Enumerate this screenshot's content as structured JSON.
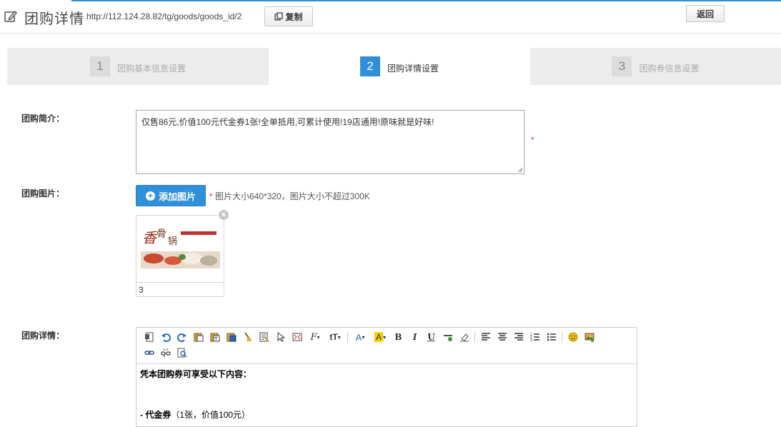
{
  "header": {
    "title": "团购详情",
    "url": "http://112.124.28.82/tg/goods/goods_id/2",
    "copy_label": "复制",
    "back_label": "返回"
  },
  "steps": [
    {
      "num": "1",
      "label": "团购基本信息设置",
      "active": false
    },
    {
      "num": "2",
      "label": "团购详情设置",
      "active": true
    },
    {
      "num": "3",
      "label": "团购券信息设置",
      "active": false
    }
  ],
  "form": {
    "intro_label": "团购简介：",
    "intro_value": "仅售86元,价值100元代金券1张!全单抵用,可累计使用!19店通用!原味就是好味!",
    "required_mark": "*",
    "image_label": "团购图片：",
    "add_image_label": "添加图片",
    "image_hint": "图片大小640*320，图片大小不超过300K",
    "thumbnail_caption": "3",
    "detail_label": "团购详情："
  },
  "editor": {
    "toolbar_row1": [
      "source-icon",
      "undo-icon",
      "redo-icon",
      "paste-icon",
      "paste-text-icon",
      "paste-word-icon",
      "clear-format-icon",
      "select-all-icon",
      "select-icon",
      "fullscreen-icon",
      "font-family-icon",
      "font-size-icon",
      "font-color-icon",
      "highlight-icon",
      "bold-icon",
      "italic-icon",
      "underline-icon",
      "hr-icon",
      "remove-format-icon",
      "align-left-icon",
      "align-center-icon",
      "align-right-icon",
      "ordered-list-icon",
      "unordered-list-icon",
      "emoticon-icon",
      "image-icon"
    ],
    "toolbar_row2": [
      "link-icon",
      "unlink-icon",
      "preview-icon"
    ],
    "content_line1": "凭本团购券可享受以下内容：",
    "content_line2_bold": "- 代金券",
    "content_line2_rest": "（1张，价值100元）"
  },
  "colors": {
    "accent": "#2f8fd8",
    "required": "#dd3333"
  }
}
